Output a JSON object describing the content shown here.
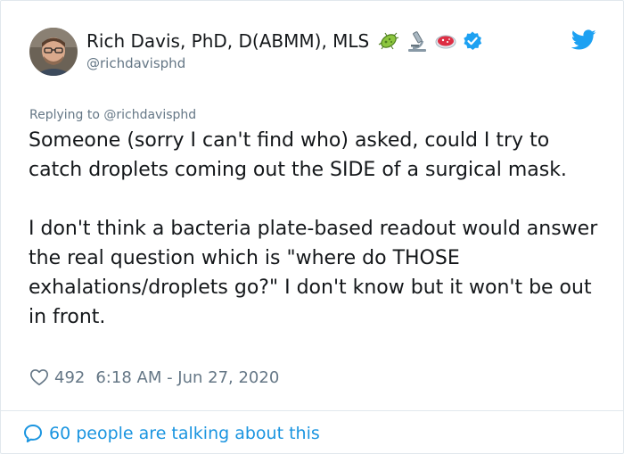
{
  "author": {
    "name": "Rich Davis, PhD, D(ABMM), MLS",
    "handle": "@richdavisphd",
    "emojis": [
      "microbe-icon",
      "microscope-icon",
      "petri-dish-icon",
      "verified-badge-icon"
    ]
  },
  "brand": {
    "logo": "twitter-bird-icon",
    "accent": "#1da1f2",
    "link_color": "#1b95e0"
  },
  "tweet": {
    "replying_to": "Replying to @richdavisphd",
    "paragraph_1": "Someone (sorry I can't find who) asked, could I try to catch droplets coming out the SIDE of a surgical mask.",
    "paragraph_2": "I don't think a bacteria plate-based readout would answer the real question which is \"where do THOSE exhalations/droplets go?\" I don't know but it won't be out in front.",
    "likes": "492",
    "timestamp": "6:18 AM - Jun 27, 2020"
  },
  "footer": {
    "conversation_text": "60 people are talking about this"
  }
}
